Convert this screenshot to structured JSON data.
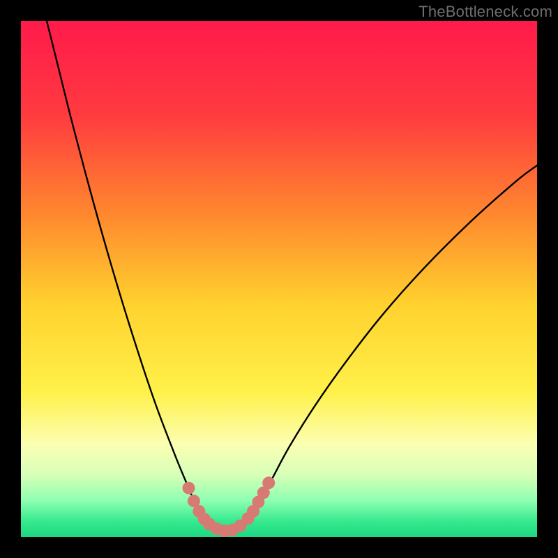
{
  "watermark": {
    "text": "TheBottleneck.com"
  },
  "chart_data": {
    "type": "line",
    "title": "",
    "xlabel": "",
    "ylabel": "",
    "xlim": [
      0,
      100
    ],
    "ylim": [
      0,
      100
    ],
    "grid": false,
    "legend": false,
    "gradient_stops": [
      {
        "offset": 0.0,
        "color": "#ff1a4b"
      },
      {
        "offset": 0.18,
        "color": "#ff3a3f"
      },
      {
        "offset": 0.38,
        "color": "#ff8a2e"
      },
      {
        "offset": 0.55,
        "color": "#ffd22e"
      },
      {
        "offset": 0.72,
        "color": "#fff14a"
      },
      {
        "offset": 0.82,
        "color": "#fbffb2"
      },
      {
        "offset": 0.88,
        "color": "#d7ffb8"
      },
      {
        "offset": 0.93,
        "color": "#8cffb0"
      },
      {
        "offset": 0.97,
        "color": "#35e98e"
      },
      {
        "offset": 1.0,
        "color": "#1fd782"
      }
    ],
    "series": [
      {
        "name": "bottleneck-curve",
        "stroke": "#000000",
        "stroke_width": 2.4,
        "points": [
          {
            "x": 5.0,
            "y": 100.0
          },
          {
            "x": 7.0,
            "y": 92.0
          },
          {
            "x": 10.0,
            "y": 80.0
          },
          {
            "x": 14.0,
            "y": 65.0
          },
          {
            "x": 18.0,
            "y": 51.0
          },
          {
            "x": 22.0,
            "y": 38.0
          },
          {
            "x": 26.0,
            "y": 26.0
          },
          {
            "x": 30.0,
            "y": 15.5
          },
          {
            "x": 32.5,
            "y": 9.5
          },
          {
            "x": 34.0,
            "y": 6.0
          },
          {
            "x": 36.0,
            "y": 3.0
          },
          {
            "x": 38.0,
            "y": 1.2
          },
          {
            "x": 40.0,
            "y": 0.8
          },
          {
            "x": 42.0,
            "y": 1.2
          },
          {
            "x": 44.0,
            "y": 3.0
          },
          {
            "x": 46.0,
            "y": 6.5
          },
          {
            "x": 48.5,
            "y": 11.0
          },
          {
            "x": 52.0,
            "y": 17.5
          },
          {
            "x": 57.0,
            "y": 25.5
          },
          {
            "x": 63.0,
            "y": 34.0
          },
          {
            "x": 70.0,
            "y": 43.0
          },
          {
            "x": 78.0,
            "y": 52.0
          },
          {
            "x": 87.0,
            "y": 61.0
          },
          {
            "x": 96.0,
            "y": 69.0
          },
          {
            "x": 100.0,
            "y": 72.0
          }
        ]
      }
    ],
    "markers": {
      "name": "highlight-dots",
      "fill": "#d87a74",
      "r": 9,
      "points": [
        {
          "x": 32.5,
          "y": 9.5
        },
        {
          "x": 33.5,
          "y": 7.0
        },
        {
          "x": 34.5,
          "y": 5.0
        },
        {
          "x": 35.5,
          "y": 3.5
        },
        {
          "x": 36.5,
          "y": 2.5
        },
        {
          "x": 38.0,
          "y": 1.6
        },
        {
          "x": 39.5,
          "y": 1.2
        },
        {
          "x": 41.0,
          "y": 1.4
        },
        {
          "x": 42.5,
          "y": 2.2
        },
        {
          "x": 44.0,
          "y": 3.6
        },
        {
          "x": 45.0,
          "y": 5.0
        },
        {
          "x": 46.0,
          "y": 6.8
        },
        {
          "x": 47.0,
          "y": 8.6
        },
        {
          "x": 48.0,
          "y": 10.5
        }
      ]
    }
  }
}
